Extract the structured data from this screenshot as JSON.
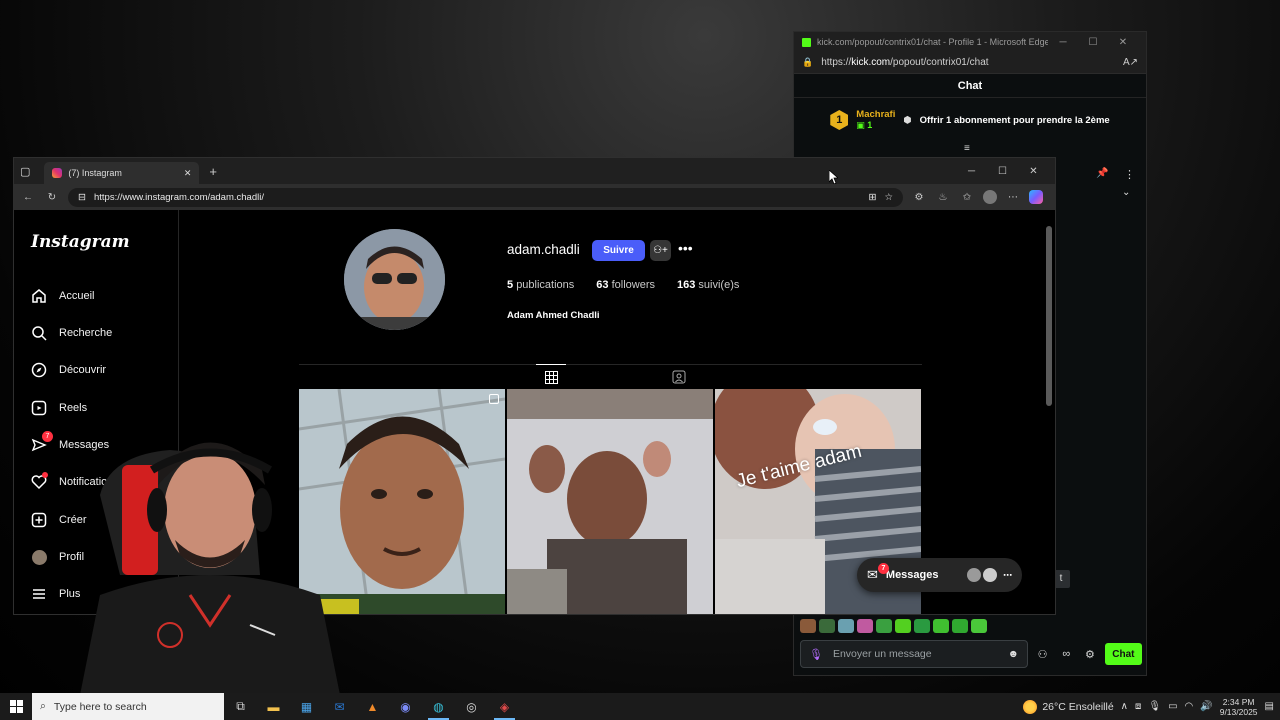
{
  "kick_window": {
    "title": "kick.com/popout/contrix01/chat - Profile 1 - Microsoft Edge",
    "url_prefix": "https://",
    "url_domain": "kick.com",
    "url_path": "/popout/contrix01/chat",
    "chat_header": "Chat",
    "gift_banner": {
      "rank": "1",
      "username": "Machrafi",
      "count": "1",
      "message": "Offrir 1 abonnement pour prendre la 2ème"
    },
    "message_placeholder": "Envoyer un message",
    "chat_button": "Chat",
    "t_button": "t",
    "brand_color": "#53fc18"
  },
  "edge_window": {
    "tab_title": "(7) Instagram",
    "url": "https://www.instagram.com/adam.chadli/"
  },
  "instagram": {
    "logo": "Instagram",
    "sidebar": [
      {
        "label": "Accueil",
        "icon": "home-icon"
      },
      {
        "label": "Recherche",
        "icon": "search-icon"
      },
      {
        "label": "Découvrir",
        "icon": "compass-icon"
      },
      {
        "label": "Reels",
        "icon": "reels-icon"
      },
      {
        "label": "Messages",
        "icon": "messenger-icon",
        "badge": "7"
      },
      {
        "label": "Notifications",
        "icon": "heart-icon"
      },
      {
        "label": "Créer",
        "icon": "plus-square-icon"
      },
      {
        "label": "Profil",
        "icon": "avatar-icon"
      },
      {
        "label": "Plus",
        "icon": "menu-icon"
      }
    ],
    "profile": {
      "username": "adam.chadli",
      "follow_button": "Suivre",
      "posts_count": "5",
      "posts_label": "publications",
      "followers_count": "63",
      "followers_label": "followers",
      "following_count": "163",
      "following_label": "suivi(e)s",
      "full_name": "Adam Ahmed Chadli"
    },
    "post_overlay_text": "Je t'aime adam",
    "messages_pill": {
      "label": "Messages",
      "badge": "7"
    },
    "accent_color": "#4a5df9"
  },
  "taskbar": {
    "search_placeholder": "Type here to search",
    "weather": "26°C  Ensoleillé",
    "time": "2:34 PM",
    "date": "9/13/2025"
  }
}
